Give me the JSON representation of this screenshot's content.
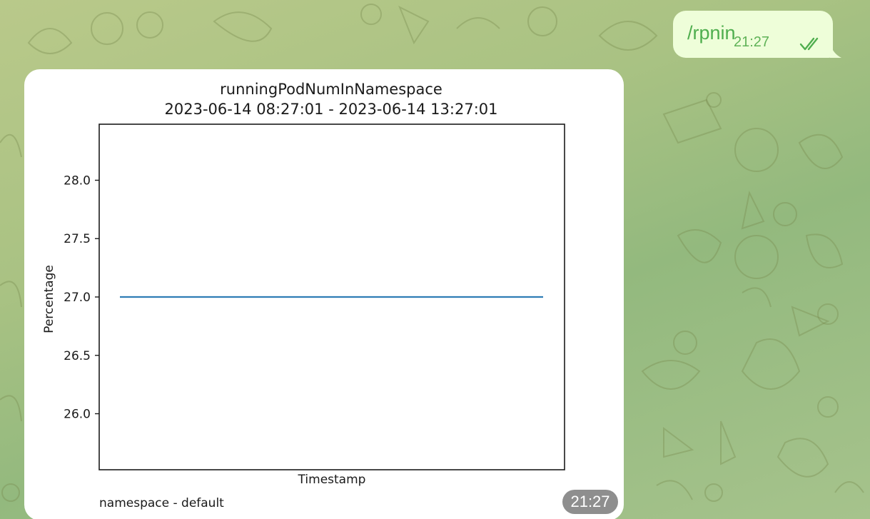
{
  "outgoing_message": {
    "text": "/rpnin",
    "time": "21:27",
    "status_icon": "double-check-icon"
  },
  "incoming_photo": {
    "caption": "namespace - default",
    "time": "21:27"
  },
  "chart_data": {
    "type": "line",
    "title": "runningPodNumInNamespace",
    "subtitle": "2023-06-14 08:27:01 - 2023-06-14 13:27:01",
    "xlabel": "Timestamp",
    "ylabel": "Percentage",
    "ylim": [
      25.52,
      28.48
    ],
    "yticks": [
      26.0,
      26.5,
      27.0,
      27.5,
      28.0
    ],
    "ytick_labels": [
      "26.0",
      "26.5",
      "27.0",
      "27.5",
      "28.0"
    ],
    "x_tick_labels": [],
    "grid": false,
    "line_color": "#2f7db5",
    "series": [
      {
        "values": [
          27.0,
          27.0
        ]
      }
    ]
  }
}
